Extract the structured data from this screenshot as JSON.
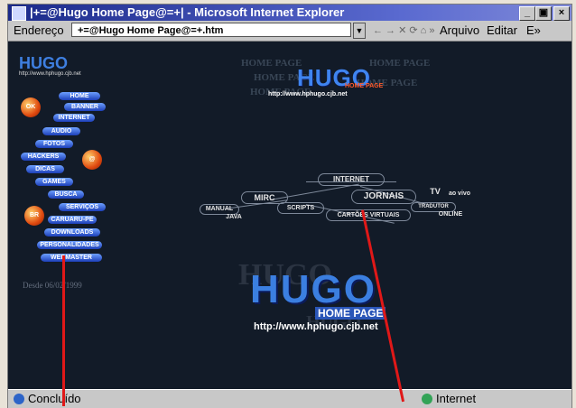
{
  "window": {
    "title": "|+=@Hugo Home Page@=+| - Microsoft Internet Explorer",
    "minimize": "_",
    "restore": "▣",
    "close": "×"
  },
  "addressbar": {
    "label": "Endereço",
    "value": "+=@Hugo Home Page@=+.htm",
    "nav": "← → ✕ ⟳ ⌂ »",
    "menu": [
      "Arquivo",
      "Editar",
      "E»"
    ]
  },
  "sidebar": {
    "logo": "HUGO",
    "url": "http://www.hphugo.cjb.net",
    "items": [
      "HOME",
      "BANNER",
      "INTERNET",
      "AUDIO",
      "FOTOS",
      "HACKERS",
      "DICAS",
      "GAMES",
      "BUSCA",
      "SERVIÇOS",
      "CARUARU-PE",
      "DOWNLOADS",
      "PERSONALIDADES",
      "WEBMASTER"
    ],
    "since": "Desde 06/02/1999",
    "orbs": [
      "OK",
      "@",
      "BR"
    ]
  },
  "header": {
    "logo": "HUGO",
    "subtitle": "HOME PAGE",
    "url": "http://www.hphugo.cjb.net"
  },
  "sitemap": {
    "nodes": [
      "INTERNET",
      "MIRC",
      "JORNAIS",
      "TV",
      "ao vivo",
      "MANUAL",
      "JAVA",
      "SCRIPTS",
      "CARTÕES VIRTUAIS",
      "TRADUTOR",
      "ONLINE"
    ]
  },
  "banner": {
    "logo": "HUGO",
    "subtitle": "HOME PAGE",
    "url": "http://www.hphugo.cjb.net"
  },
  "statusbar": {
    "status": "Concluído",
    "zone": "Internet"
  },
  "colors": {
    "page_bg": "#121b28",
    "accent": "#3f84f0",
    "pointer": "#e01818"
  }
}
